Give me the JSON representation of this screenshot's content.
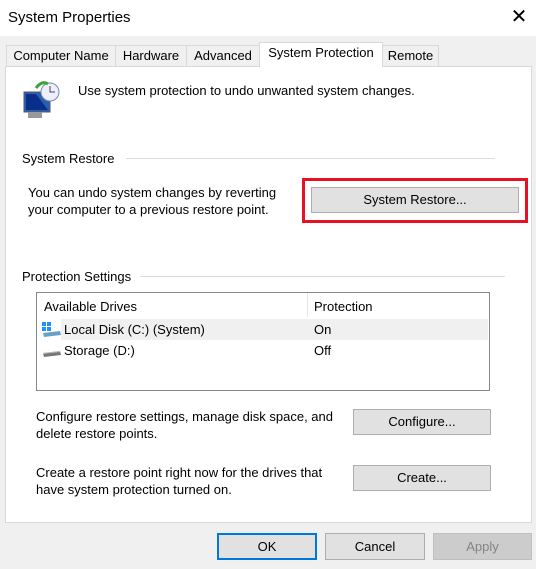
{
  "window": {
    "title": "System Properties",
    "close": "✕"
  },
  "tabs": [
    {
      "label": "Computer Name"
    },
    {
      "label": "Hardware"
    },
    {
      "label": "Advanced"
    },
    {
      "label": "System Protection",
      "selected": true
    },
    {
      "label": "Remote"
    }
  ],
  "intro": "Use system protection to undo unwanted system changes.",
  "system_restore": {
    "group_label": "System Restore",
    "line1": "You can undo system changes by reverting",
    "line2": "your computer to a previous restore point.",
    "button": "System Restore...",
    "highlight_color": "#e81123"
  },
  "protection": {
    "group_label": "Protection Settings",
    "columns": [
      "Available Drives",
      "Protection"
    ],
    "drives": [
      {
        "name": "Local Disk (C:) (System)",
        "protection": "On",
        "icon": "system-drive-icon"
      },
      {
        "name": "Storage (D:)",
        "protection": "Off",
        "icon": "drive-icon"
      }
    ],
    "configure_line1": "Configure restore settings, manage disk space, and",
    "configure_line2": "delete restore points.",
    "configure_button": "Configure...",
    "create_line1": "Create a restore point right now for the drives that",
    "create_line2": "have system protection turned on.",
    "create_button": "Create..."
  },
  "footer": {
    "ok": "OK",
    "cancel": "Cancel",
    "apply": "Apply"
  }
}
